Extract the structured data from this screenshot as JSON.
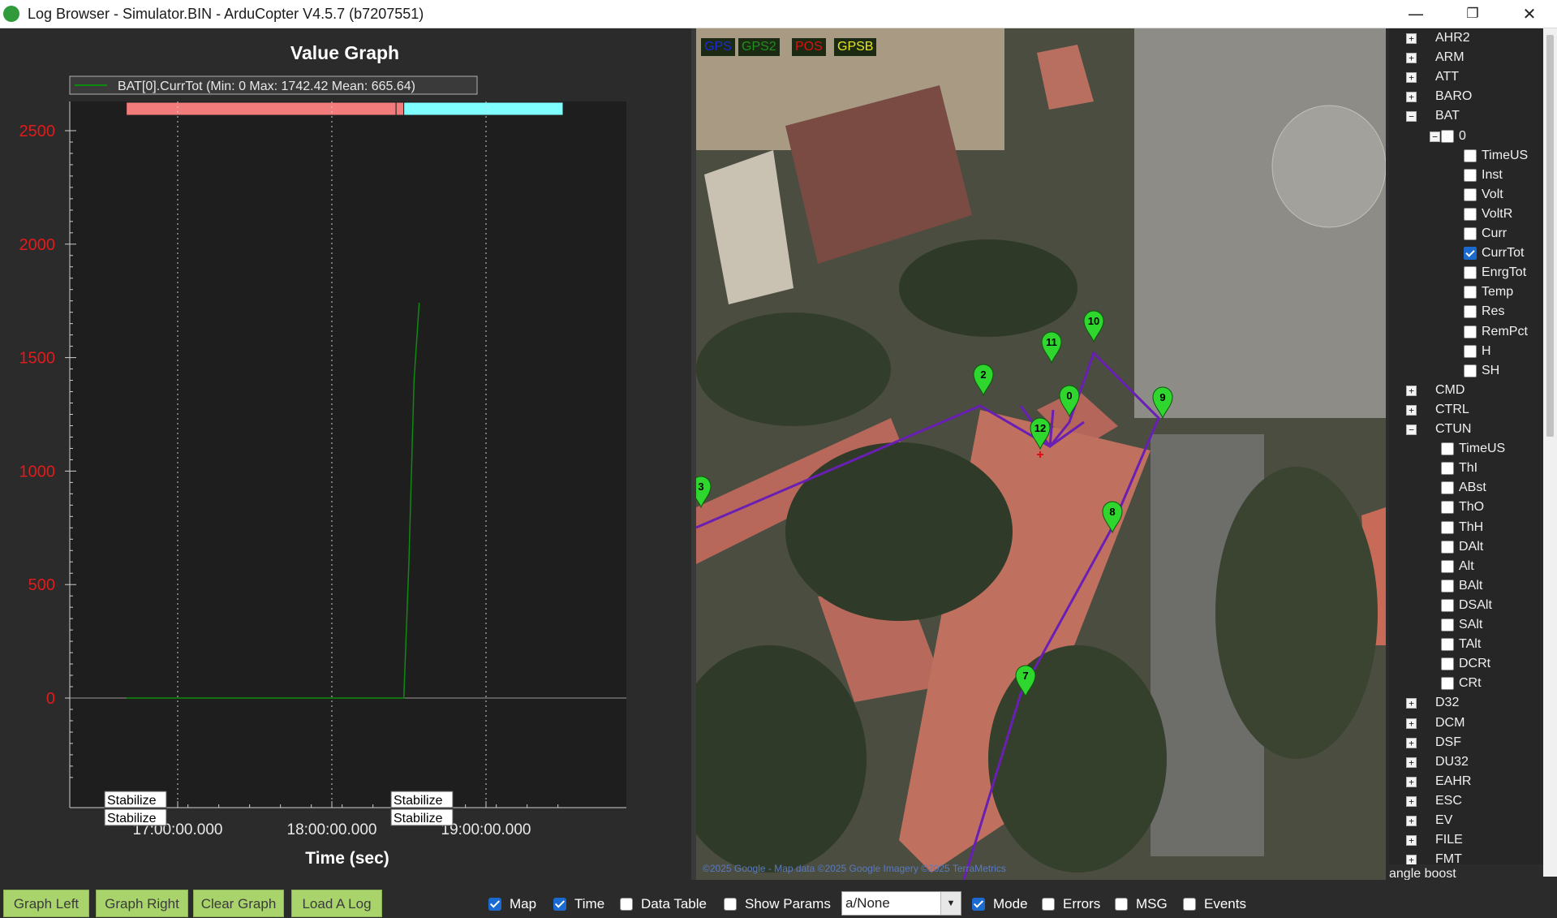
{
  "window": {
    "title": "Log Browser - Simulator.BIN - ArduCopter V4.5.7 (b7207551)",
    "min_glyph": "—",
    "max_glyph": "❐",
    "close_glyph": "✕"
  },
  "graph": {
    "title": "Value Graph",
    "legend": "BAT[0].CurrTot  (Min: 0 Max: 1742.42 Mean: 665.64)",
    "xlabel": "Time (sec)",
    "mode_labels": [
      "Stabilize",
      "Stabilize",
      "Stabilize",
      "Stabilize"
    ]
  },
  "chart_data": {
    "type": "line",
    "title": "Value Graph",
    "xlabel": "Time (sec)",
    "ylabel": "",
    "ylim": [
      -400,
      2500
    ],
    "y_ticks": [
      "0",
      "500",
      "1000",
      "1500",
      "2000",
      "2500"
    ],
    "x_ticks": [
      "17:00:00.000",
      "18:00:00.000",
      "19:00:00.000"
    ],
    "grid": "vertical dotted",
    "legend_position": "top-left",
    "series": [
      {
        "name": "BAT[0].CurrTot",
        "color": "#0f8a0f",
        "x": [
          "16:40",
          "17:30",
          "18:00",
          "18:28",
          "18:30",
          "18:32",
          "18:34"
        ],
        "values": [
          0,
          0,
          0,
          0,
          600,
          1400,
          1742
        ]
      }
    ],
    "mode_bar": [
      {
        "start": "16:40",
        "end": "18:25",
        "color": "#f27c7c"
      },
      {
        "start": "18:25",
        "end": "18:28",
        "color": "#f27c7c"
      },
      {
        "start": "18:28",
        "end": "19:30",
        "color": "#80ffff"
      }
    ]
  },
  "map": {
    "legend": [
      {
        "label": "GPS",
        "color": "#1a2bd8"
      },
      {
        "label": "GPS2",
        "color": "#1f8f1f"
      },
      {
        "label": "POS",
        "color": "#e01010"
      },
      {
        "label": "GPSB",
        "color": "#e6e620"
      }
    ],
    "waypoints": [
      "0",
      "2",
      "3",
      "7",
      "8",
      "9",
      "10",
      "11",
      "12"
    ],
    "path_color": "#6a1fb4",
    "attribution": "©2025 Google - Map data ©2025 Google Imagery ©2025 TerraMetrics"
  },
  "tree": {
    "groups_top": [
      "AHR2",
      "ARM",
      "ATT",
      "BARO",
      "BAT"
    ],
    "bat_instance": "0",
    "bat_fields": [
      "TimeUS",
      "Inst",
      "Volt",
      "VoltR",
      "Curr",
      "CurrTot",
      "EnrgTot",
      "Temp",
      "Res",
      "RemPct",
      "H",
      "SH"
    ],
    "bat_checked": "CurrTot",
    "groups_mid": [
      "CMD",
      "CTRL",
      "CTUN"
    ],
    "ctun_fields": [
      "TimeUS",
      "ThI",
      "ABst",
      "ThO",
      "ThH",
      "DAlt",
      "Alt",
      "BAlt",
      "DSAlt",
      "SAlt",
      "TAlt",
      "DCRt",
      "CRt"
    ],
    "groups_bottom": [
      "D32",
      "DCM",
      "DSF",
      "DU32",
      "EAHR",
      "ESC",
      "EV",
      "FILE",
      "FMT"
    ],
    "status": "angle boost"
  },
  "bottombar": {
    "buttons": [
      "Graph Left",
      "Graph Right",
      "Clear Graph",
      "Load A Log"
    ],
    "map_label": "Map",
    "time_label": "Time",
    "datatable_label": "Data Table",
    "showparams_label": "Show Params",
    "mode_value": "a/None",
    "mode_label": "Mode",
    "errors_label": "Errors",
    "msg_label": "MSG",
    "events_label": "Events"
  }
}
